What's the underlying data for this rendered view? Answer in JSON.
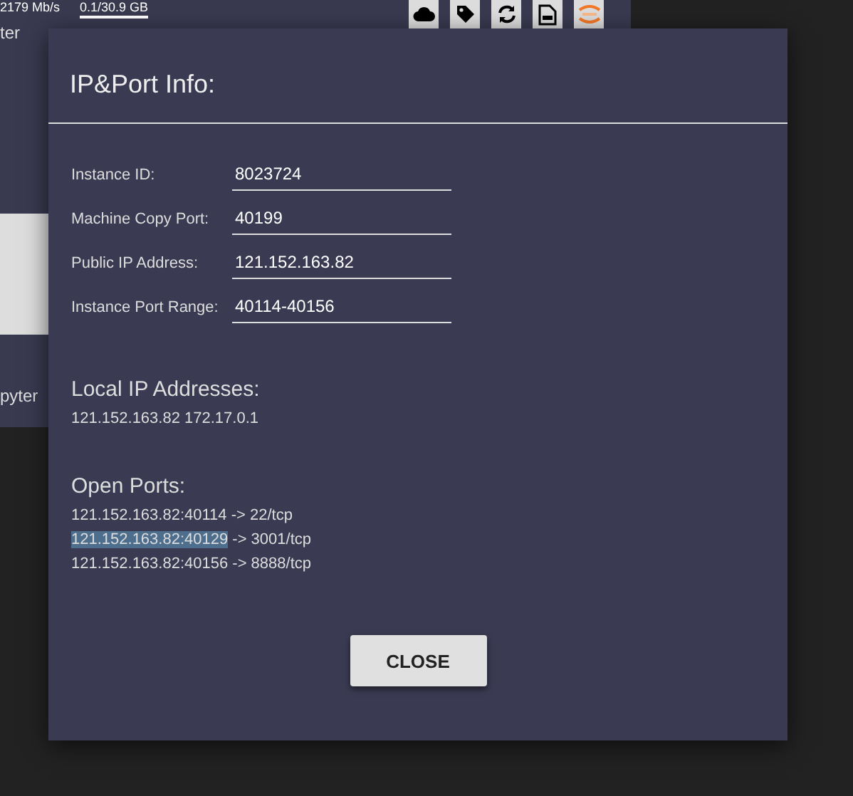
{
  "background": {
    "speed": "2179 Mb/s",
    "storage": "0.1/30.9 GB",
    "label_top": "ter",
    "label_bottom": "pyter",
    "toolbar": [
      {
        "kind": "cloud"
      },
      {
        "kind": "tag"
      },
      {
        "kind": "refresh"
      },
      {
        "kind": "document"
      },
      {
        "kind": "jupyter"
      }
    ]
  },
  "dialog": {
    "title": "IP&Port Info:",
    "fields": [
      {
        "label": "Instance ID:",
        "value": "8023724"
      },
      {
        "label": "Machine Copy Port:",
        "value": "40199"
      },
      {
        "label": "Public IP Address:",
        "value": "121.152.163.82"
      },
      {
        "label": "Instance Port Range:",
        "value": "40114-40156"
      }
    ],
    "local_heading": "Local IP Addresses:",
    "local_addresses": "121.152.163.82 172.17.0.1",
    "ports_heading": "Open Ports:",
    "ports": [
      {
        "address": "121.152.163.82:40114",
        "mapping": " -> 22/tcp",
        "highlighted": false
      },
      {
        "address": "121.152.163.82:40129",
        "mapping": " -> 3001/tcp",
        "highlighted": true
      },
      {
        "address": "121.152.163.82:40156",
        "mapping": " -> 8888/tcp",
        "highlighted": false
      }
    ],
    "close_button": "CLOSE"
  }
}
